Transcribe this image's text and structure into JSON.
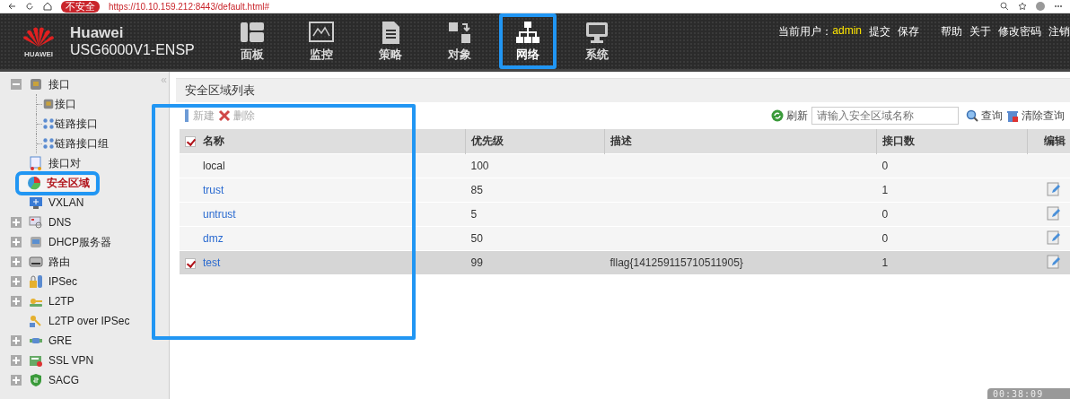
{
  "browser": {
    "security_badge": "不安全",
    "url": "https://10.10.159.212:8443/default.html#"
  },
  "header": {
    "brand": "Huawei",
    "logo_text": "HUAWEI",
    "model": "USG6000V1-ENSP",
    "nav": [
      {
        "label": "面板",
        "selected": false,
        "highlighted": false
      },
      {
        "label": "监控",
        "selected": false,
        "highlighted": false
      },
      {
        "label": "策略",
        "selected": false,
        "highlighted": false
      },
      {
        "label": "对象",
        "selected": false,
        "highlighted": false
      },
      {
        "label": "网络",
        "selected": true,
        "highlighted": true
      },
      {
        "label": "系统",
        "selected": false,
        "highlighted": false
      }
    ],
    "user_label": "当前用户：",
    "user": "admin",
    "links": [
      "提交",
      "保存",
      "帮助",
      "关于",
      "修改密码",
      "注销"
    ]
  },
  "sidebar": {
    "collapse": "«",
    "items": [
      {
        "label": "接口",
        "expanded": true,
        "selected": false,
        "highlighted": false,
        "children": [
          {
            "label": "接口"
          },
          {
            "label": "链路接口"
          },
          {
            "label": "链路接口组"
          }
        ]
      },
      {
        "label": "接口对",
        "selected": false,
        "highlighted": false
      },
      {
        "label": "安全区域",
        "selected": true,
        "highlighted": true
      },
      {
        "label": "VXLAN",
        "selected": false,
        "highlighted": false
      },
      {
        "label": "DNS",
        "expanded": false,
        "selected": false,
        "highlighted": false
      },
      {
        "label": "DHCP服务器",
        "expanded": false,
        "selected": false,
        "highlighted": false
      },
      {
        "label": "路由",
        "expanded": false,
        "selected": false,
        "highlighted": false
      },
      {
        "label": "IPSec",
        "expanded": false,
        "selected": false,
        "highlighted": false
      },
      {
        "label": "L2TP",
        "expanded": false,
        "selected": false,
        "highlighted": false
      },
      {
        "label": "L2TP over IPSec",
        "selected": false,
        "highlighted": false
      },
      {
        "label": "GRE",
        "expanded": false,
        "selected": false,
        "highlighted": false
      },
      {
        "label": "SSL VPN",
        "expanded": false,
        "selected": false,
        "highlighted": false
      },
      {
        "label": "SACG",
        "expanded": false,
        "selected": false,
        "highlighted": false
      }
    ]
  },
  "panel": {
    "title": "安全区域列表",
    "toolbar": {
      "new": "新建",
      "delete": "删除",
      "refresh": "刷新",
      "search": {
        "placeholder": "请输入安全区域名称"
      },
      "query": "查询",
      "clear": "清除查询"
    },
    "table": {
      "header_checked": true,
      "name_column_highlighted": true,
      "columns": [
        "名称",
        "优先级",
        "描述",
        "接口数",
        "编辑"
      ],
      "rows": [
        {
          "name": "local",
          "link": false,
          "priority": "100",
          "description": "",
          "interfaces": "0",
          "editable": false,
          "selected": false
        },
        {
          "name": "trust",
          "link": true,
          "priority": "85",
          "interfaces": "1",
          "editable": true,
          "selected": false
        },
        {
          "name": "untrust",
          "link": true,
          "priority": "5",
          "interfaces": "0",
          "editable": true,
          "selected": false
        },
        {
          "name": "dmz",
          "link": true,
          "priority": "50",
          "interfaces": "0",
          "editable": true,
          "selected": false
        },
        {
          "name": "test",
          "link": true,
          "priority": "99",
          "description": "fllag{141259115710511905}",
          "interfaces": "1",
          "editable": true,
          "selected": true
        }
      ]
    }
  },
  "timer": "00:38:09"
}
